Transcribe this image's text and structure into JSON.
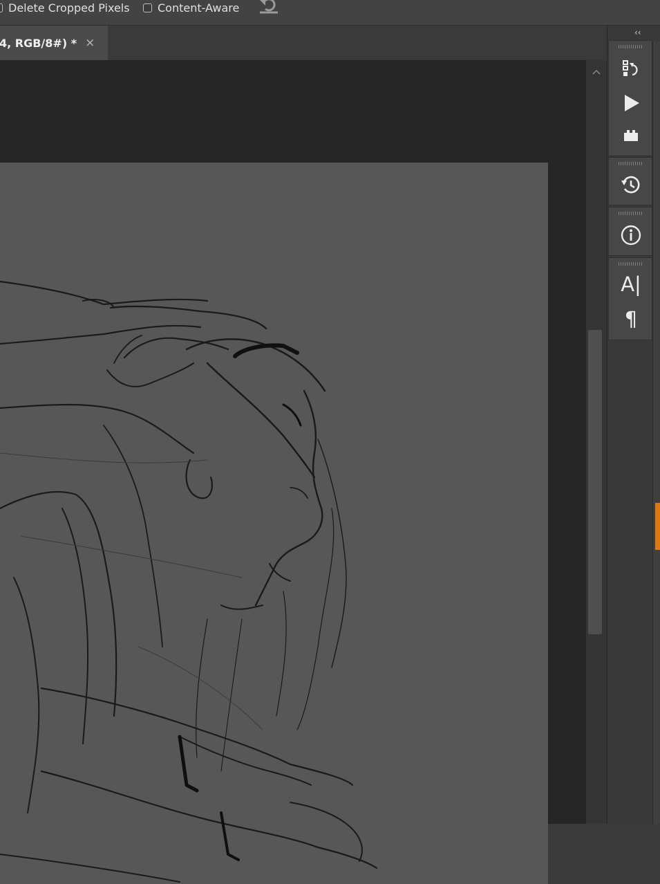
{
  "options_bar": {
    "delete_cropped_label": "Delete Cropped Pixels",
    "content_aware_label": "Content-Aware",
    "delete_cropped_checked": false,
    "content_aware_checked": false
  },
  "document_tab": {
    "title": "4, RGB/8#) *",
    "close_glyph": "×"
  },
  "dock": {
    "collapse_glyph": "‹‹",
    "panels": [
      {
        "name": "history-states-icon"
      },
      {
        "name": "actions-play-icon"
      },
      {
        "name": "plugins-icon"
      },
      {
        "name": "history-icon"
      },
      {
        "name": "info-icon"
      },
      {
        "name": "character-icon",
        "glyph": "A|"
      },
      {
        "name": "paragraph-icon",
        "glyph": "¶"
      }
    ]
  },
  "colors": {
    "canvas": "#575757",
    "pasteboard": "#262626",
    "accent": "#d97b12"
  }
}
